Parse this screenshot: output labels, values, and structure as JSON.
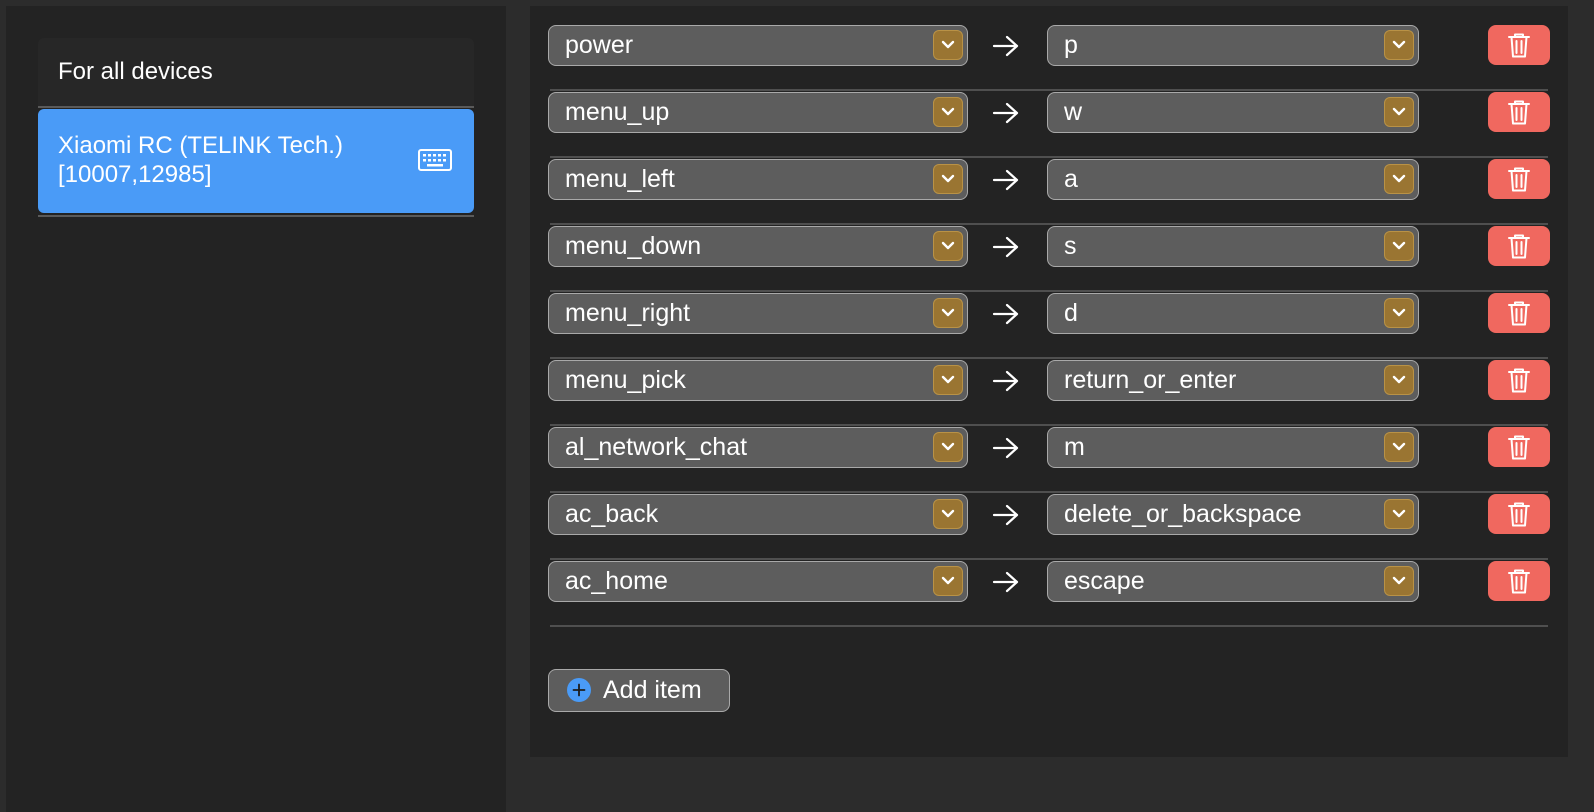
{
  "sidebar": {
    "all_devices_label": "For all devices",
    "selected_device": {
      "name_line1": "Xiaomi RC (TELINK Tech.)",
      "name_line2": "[10007,12985]",
      "icon": "keyboard-icon"
    }
  },
  "mappings": [
    {
      "from": "power",
      "to": "p"
    },
    {
      "from": "menu_up",
      "to": "w"
    },
    {
      "from": "menu_left",
      "to": "a"
    },
    {
      "from": "menu_down",
      "to": "s"
    },
    {
      "from": "menu_right",
      "to": "d"
    },
    {
      "from": "menu_pick",
      "to": "return_or_enter"
    },
    {
      "from": "al_network_chat",
      "to": "m"
    },
    {
      "from": "ac_back",
      "to": "delete_or_backspace"
    },
    {
      "from": "ac_home",
      "to": "escape"
    }
  ],
  "add_button": {
    "label": "Add item",
    "icon": "plus-circle-icon"
  },
  "colors": {
    "selected_device_bg": "#4a9bf7",
    "chevron_bg": "#9a7532",
    "delete_button_bg": "#f0685f",
    "add_icon": "#4a9bf7"
  }
}
